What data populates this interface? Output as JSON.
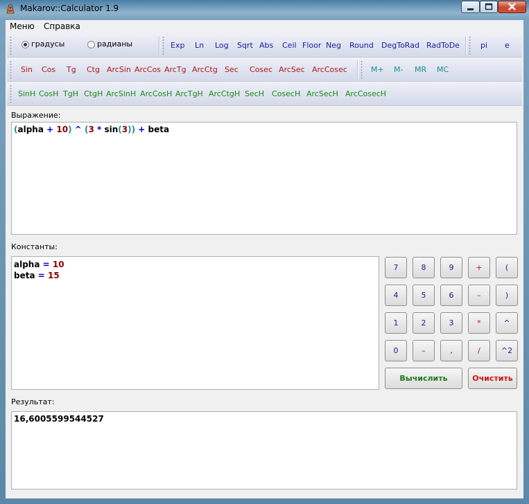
{
  "window": {
    "title": "Makarov::Calculator 1.9"
  },
  "menu": {
    "items": [
      "Меню",
      "Справка"
    ]
  },
  "angle_mode": {
    "degrees_label": "градусы",
    "radians_label": "радианы",
    "selected": "градусы"
  },
  "toolbar1": {
    "buttons": [
      "Exp",
      "Ln",
      "Log",
      "Sqrt",
      "Abs",
      "Ceil",
      "Floor",
      "Neg",
      "Round",
      "DegToRad",
      "RadToDe"
    ],
    "constants": [
      "pi",
      "e"
    ]
  },
  "toolbar2": {
    "trig": [
      "Sin",
      "Cos",
      "Tg",
      "Ctg",
      "ArcSin",
      "ArcCos",
      "ArcTg",
      "ArcCtg",
      "Sec",
      "Cosec",
      "ArcSec",
      "ArcCosec"
    ],
    "memory": [
      "M+",
      "M-",
      "MR",
      "MC"
    ]
  },
  "toolbar3": {
    "hyperbolic": [
      "SinH",
      "CosH",
      "TgH",
      "CtgH",
      "ArcSinH",
      "ArcCosH",
      "ArcTgH",
      "ArcCtgH",
      "SecH",
      "CosecH",
      "ArcSecH",
      "ArcCosecH"
    ]
  },
  "expression": {
    "label": "Выражение:",
    "tokens": [
      {
        "t": "(",
        "c": "paren"
      },
      {
        "t": "alpha",
        "c": "var"
      },
      {
        "t": " + ",
        "c": "op"
      },
      {
        "t": "10",
        "c": "num"
      },
      {
        "t": ")",
        "c": "paren"
      },
      {
        "t": " ^ ",
        "c": "op"
      },
      {
        "t": "(",
        "c": "paren"
      },
      {
        "t": "3",
        "c": "num"
      },
      {
        "t": " * ",
        "c": "op"
      },
      {
        "t": "sin",
        "c": "fn"
      },
      {
        "t": "(",
        "c": "paren"
      },
      {
        "t": "3",
        "c": "num"
      },
      {
        "t": "))",
        "c": "paren"
      },
      {
        "t": " + ",
        "c": "op"
      },
      {
        "t": "beta",
        "c": "var"
      }
    ]
  },
  "constants": {
    "label": "Константы:",
    "lines": [
      [
        {
          "t": "alpha",
          "c": "var"
        },
        {
          "t": " = ",
          "c": "op"
        },
        {
          "t": "10",
          "c": "num"
        }
      ],
      [
        {
          "t": "beta",
          "c": "var"
        },
        {
          "t": " = ",
          "c": "op"
        },
        {
          "t": "15",
          "c": "num"
        }
      ]
    ]
  },
  "keypad": {
    "rows": [
      [
        {
          "k": "7",
          "c": "num"
        },
        {
          "k": "8",
          "c": "num"
        },
        {
          "k": "9",
          "c": "num"
        },
        {
          "k": "+",
          "c": "op"
        },
        {
          "k": "(",
          "c": "num"
        }
      ],
      [
        {
          "k": "4",
          "c": "num"
        },
        {
          "k": "5",
          "c": "num"
        },
        {
          "k": "6",
          "c": "num"
        },
        {
          "k": "–",
          "c": "op"
        },
        {
          "k": ")",
          "c": "num"
        }
      ],
      [
        {
          "k": "1",
          "c": "num"
        },
        {
          "k": "2",
          "c": "num"
        },
        {
          "k": "3",
          "c": "num"
        },
        {
          "k": "*",
          "c": "op"
        },
        {
          "k": "^",
          "c": "num"
        }
      ],
      [
        {
          "k": "0",
          "c": "num"
        },
        {
          "k": "–",
          "c": "num"
        },
        {
          "k": ",",
          "c": "num"
        },
        {
          "k": "/",
          "c": "op"
        },
        {
          "k": "^2",
          "c": "num"
        }
      ]
    ],
    "calculate_label": "Вычислить",
    "clear_label": "Очистить"
  },
  "result": {
    "label": "Результат:",
    "value": "16,6005599544527"
  },
  "colors": {
    "calculate": "#1a7a1a",
    "clear": "#d01010"
  }
}
